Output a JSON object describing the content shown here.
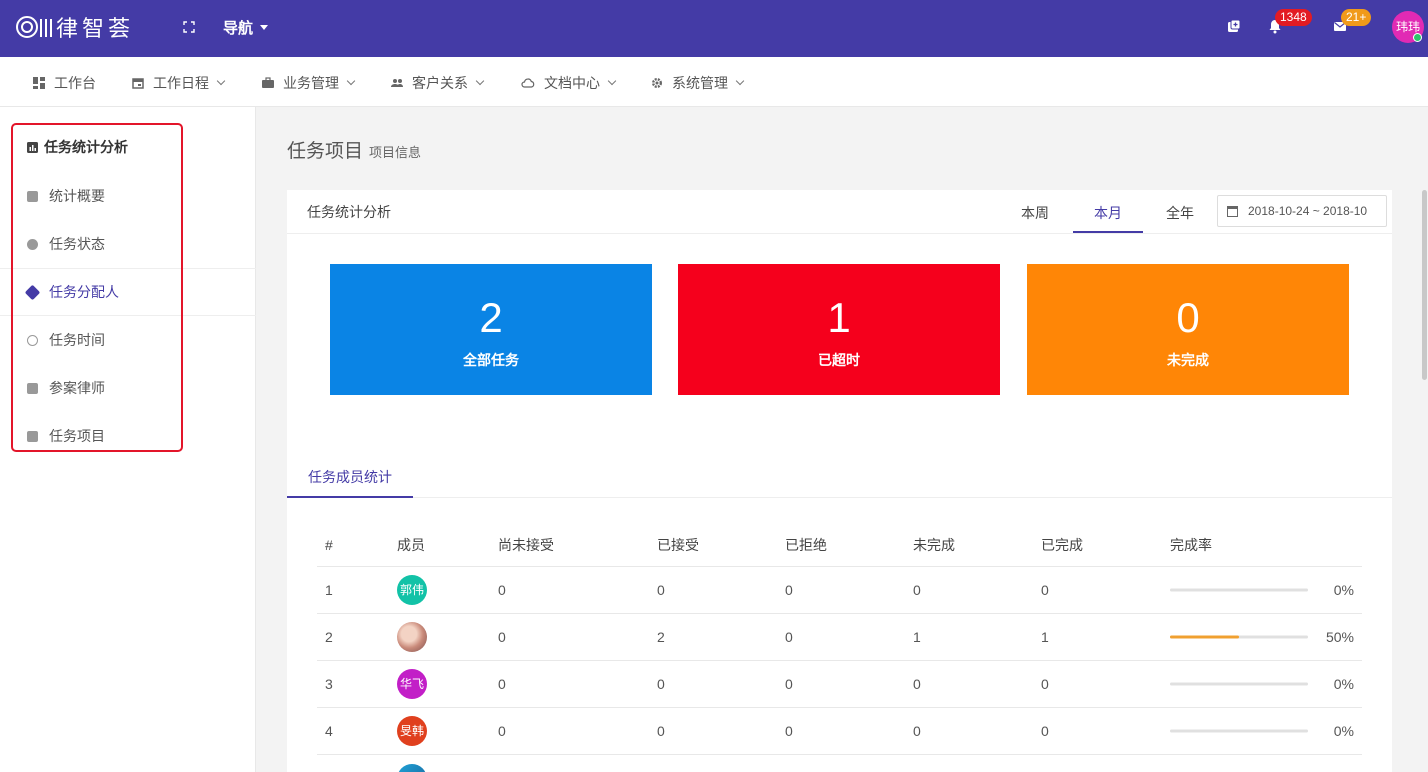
{
  "header": {
    "logo_text": "律智荟",
    "nav_label": "导航",
    "notifications_count": "1348",
    "messages_count": "21+",
    "user_avatar_text": "玮玮",
    "colors": {
      "bar": "#443ba6",
      "bell_badge": "#e31b23",
      "mail_badge": "#f09a1a",
      "avatar": "#e12ab4"
    }
  },
  "menu": {
    "items": [
      {
        "label": "工作台",
        "icon": "dashboard-icon"
      },
      {
        "label": "工作日程",
        "icon": "calendar-icon"
      },
      {
        "label": "业务管理",
        "icon": "briefcase-icon"
      },
      {
        "label": "客户关系",
        "icon": "people-icon"
      },
      {
        "label": "文档中心",
        "icon": "cloud-icon"
      },
      {
        "label": "系统管理",
        "icon": "gear-icon"
      }
    ]
  },
  "sidebar": {
    "title": "任务统计分析",
    "items": [
      {
        "label": "统计概要",
        "icon": "grid-icon"
      },
      {
        "label": "任务状态",
        "icon": "compass-icon"
      },
      {
        "label": "任务分配人",
        "icon": "tag-icon"
      },
      {
        "label": "任务时间",
        "icon": "clock-icon"
      },
      {
        "label": "参案律师",
        "icon": "person-card-icon"
      },
      {
        "label": "任务项目",
        "icon": "clipboard-icon"
      }
    ]
  },
  "page": {
    "title": "任务项目",
    "subtitle": "项目信息"
  },
  "card": {
    "title": "任务统计分析",
    "periods": [
      "本周",
      "本月",
      "全年"
    ],
    "active_period": "本月",
    "date_range": "2018-10-24 ~ 2018-10",
    "stats": [
      {
        "value": "2",
        "label": "全部任务",
        "color": "#0a84e5"
      },
      {
        "value": "1",
        "label": "已超时",
        "color": "#f5001c"
      },
      {
        "value": "0",
        "label": "未完成",
        "color": "#ff8606"
      }
    ],
    "sub_tab": "任务成员统计"
  },
  "table": {
    "headers": [
      "#",
      "成员",
      "尚未接受",
      "已接受",
      "已拒绝",
      "未完成",
      "已完成",
      "完成率"
    ],
    "rows": [
      {
        "index": "1",
        "member": "郭伟",
        "avatar_color": "#12c2a7",
        "pending": "0",
        "accepted": "0",
        "rejected": "0",
        "unfinished": "0",
        "finished": "0",
        "rate_label": "0%",
        "rate": 0
      },
      {
        "index": "2",
        "member": "",
        "avatar_color": "#d9a08c",
        "pending": "0",
        "accepted": "2",
        "rejected": "0",
        "unfinished": "1",
        "finished": "1",
        "rate_label": "50%",
        "rate": 0.5
      },
      {
        "index": "3",
        "member": "华飞",
        "avatar_color": "#c21fc7",
        "pending": "0",
        "accepted": "0",
        "rejected": "0",
        "unfinished": "0",
        "finished": "0",
        "rate_label": "0%",
        "rate": 0
      },
      {
        "index": "4",
        "member": "旻韩",
        "avatar_color": "#e0401e",
        "pending": "0",
        "accepted": "0",
        "rejected": "0",
        "unfinished": "0",
        "finished": "0",
        "rate_label": "0%",
        "rate": 0
      }
    ]
  }
}
